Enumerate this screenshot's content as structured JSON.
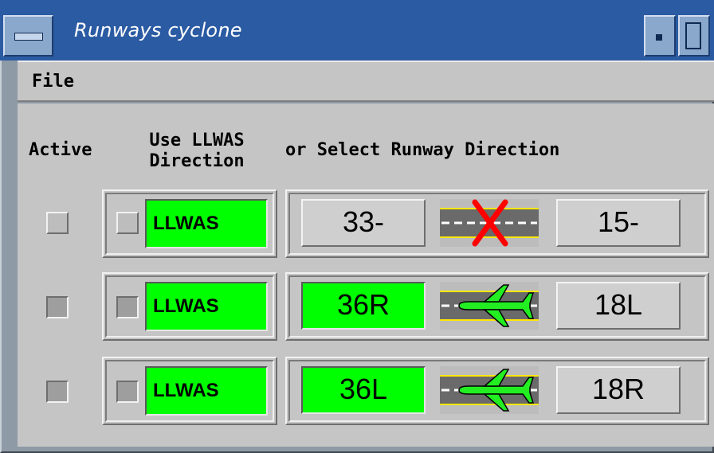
{
  "window": {
    "title": "Runways cyclone"
  },
  "menu": {
    "file": "File"
  },
  "headers": {
    "active": "Active",
    "use_llwas_line1": "Use LLWAS",
    "use_llwas_line2": "Direction",
    "select": "or Select Runway Direction"
  },
  "rows": [
    {
      "llwas_label": "LLWAS",
      "left_label": "33-",
      "left_selected": false,
      "right_label": "15-",
      "right_selected": false,
      "icon": "runway-closed-icon"
    },
    {
      "llwas_label": "LLWAS",
      "left_label": "36R",
      "left_selected": true,
      "right_label": "18L",
      "right_selected": false,
      "icon": "airplane-icon"
    },
    {
      "llwas_label": "LLWAS",
      "left_label": "36L",
      "left_selected": true,
      "right_label": "18R",
      "right_selected": false,
      "icon": "airplane-icon"
    }
  ],
  "colors": {
    "active_green": "#00ff00",
    "title_bar": "#2b5ba3",
    "panel_gray": "#c5c5c5",
    "closed_red": "#ff0000"
  }
}
